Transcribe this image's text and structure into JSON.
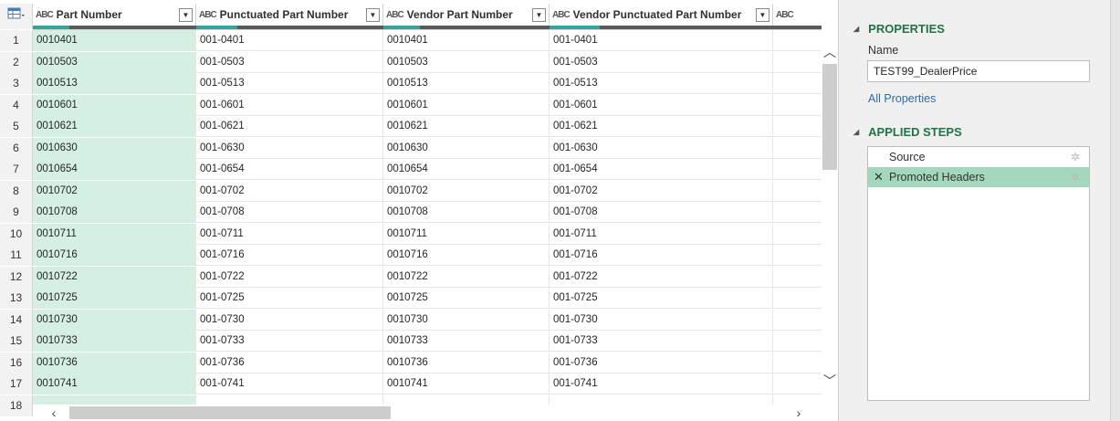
{
  "columns": [
    {
      "type_icon": "ABC",
      "label": "Part Number"
    },
    {
      "type_icon": "ABC",
      "label": "Punctuated Part Number"
    },
    {
      "type_icon": "ABC",
      "label": "Vendor Part Number"
    },
    {
      "type_icon": "ABC",
      "label": "Vendor Punctuated Part Number"
    },
    {
      "type_icon": "ABC",
      "label": ""
    }
  ],
  "rows": [
    {
      "n": "1",
      "cells": [
        "0010401",
        "001-0401",
        "0010401",
        "001-0401"
      ]
    },
    {
      "n": "2",
      "cells": [
        "0010503",
        "001-0503",
        "0010503",
        "001-0503"
      ]
    },
    {
      "n": "3",
      "cells": [
        "0010513",
        "001-0513",
        "0010513",
        "001-0513"
      ]
    },
    {
      "n": "4",
      "cells": [
        "0010601",
        "001-0601",
        "0010601",
        "001-0601"
      ]
    },
    {
      "n": "5",
      "cells": [
        "0010621",
        "001-0621",
        "0010621",
        "001-0621"
      ]
    },
    {
      "n": "6",
      "cells": [
        "0010630",
        "001-0630",
        "0010630",
        "001-0630"
      ]
    },
    {
      "n": "7",
      "cells": [
        "0010654",
        "001-0654",
        "0010654",
        "001-0654"
      ]
    },
    {
      "n": "8",
      "cells": [
        "0010702",
        "001-0702",
        "0010702",
        "001-0702"
      ]
    },
    {
      "n": "9",
      "cells": [
        "0010708",
        "001-0708",
        "0010708",
        "001-0708"
      ]
    },
    {
      "n": "10",
      "cells": [
        "0010711",
        "001-0711",
        "0010711",
        "001-0711"
      ]
    },
    {
      "n": "11",
      "cells": [
        "0010716",
        "001-0716",
        "0010716",
        "001-0716"
      ]
    },
    {
      "n": "12",
      "cells": [
        "0010722",
        "001-0722",
        "0010722",
        "001-0722"
      ]
    },
    {
      "n": "13",
      "cells": [
        "0010725",
        "001-0725",
        "0010725",
        "001-0725"
      ]
    },
    {
      "n": "14",
      "cells": [
        "0010730",
        "001-0730",
        "0010730",
        "001-0730"
      ]
    },
    {
      "n": "15",
      "cells": [
        "0010733",
        "001-0733",
        "0010733",
        "001-0733"
      ]
    },
    {
      "n": "16",
      "cells": [
        "0010736",
        "001-0736",
        "0010736",
        "001-0736"
      ]
    },
    {
      "n": "17",
      "cells": [
        "0010741",
        "001-0741",
        "0010741",
        "001-0741"
      ]
    },
    {
      "n": "18",
      "cells": [
        "",
        "",
        "",
        ""
      ]
    }
  ],
  "properties": {
    "section_title": "PROPERTIES",
    "name_label": "Name",
    "name_value": "TEST99_DealerPrice",
    "all_properties_link": "All Properties"
  },
  "applied_steps": {
    "section_title": "APPLIED STEPS",
    "steps": [
      {
        "label": "Source",
        "selected": false
      },
      {
        "label": "Promoted Headers",
        "selected": true
      }
    ]
  },
  "colors": {
    "accent_green": "#217346",
    "selected_step": "#a4d8bc",
    "selected_column": "#d5f0e2",
    "quality_bar": "#38a29a"
  },
  "icons": [
    "table-menu-icon",
    "abc-type-icon",
    "dropdown-arrow-icon",
    "scroll-up-icon",
    "scroll-down-icon",
    "scroll-left-icon",
    "scroll-right-icon",
    "collapse-triangle-icon",
    "gear-icon",
    "delete-step-icon"
  ]
}
